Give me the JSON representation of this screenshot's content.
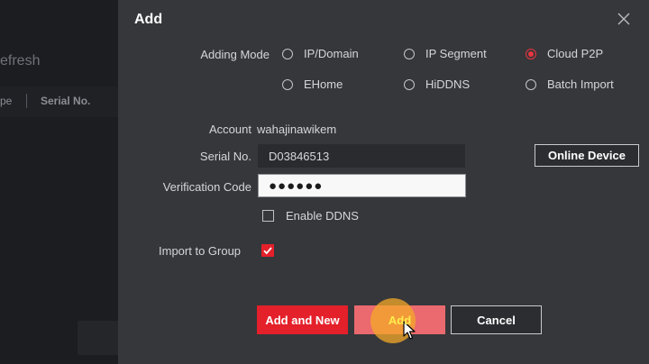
{
  "background": {
    "refresh_label": "efresh",
    "col_type": "pe",
    "col_serial": "Serial No."
  },
  "dialog": {
    "title": "Add",
    "adding_mode": {
      "label": "Adding Mode",
      "options": [
        "IP/Domain",
        "IP Segment",
        "Cloud P2P",
        "EHome",
        "HiDDNS",
        "Batch Import"
      ],
      "selected": "Cloud P2P"
    },
    "account": {
      "label": "Account",
      "value": "wahajinawikem"
    },
    "serial": {
      "label": "Serial No.",
      "value": "D03846513"
    },
    "online_device_label": "Online Device",
    "verification": {
      "label": "Verification Code",
      "value": "●●●●●●"
    },
    "enable_ddns": {
      "label": "Enable DDNS",
      "checked": false
    },
    "import_group": {
      "label": "Import to Group",
      "checked": true
    },
    "buttons": {
      "add_and_new": "Add and New",
      "add": "Add",
      "cancel": "Cancel"
    }
  },
  "colors": {
    "accent": "#e4202a",
    "dialog_bg": "#36373b",
    "app_bg": "#1a1b1e"
  }
}
